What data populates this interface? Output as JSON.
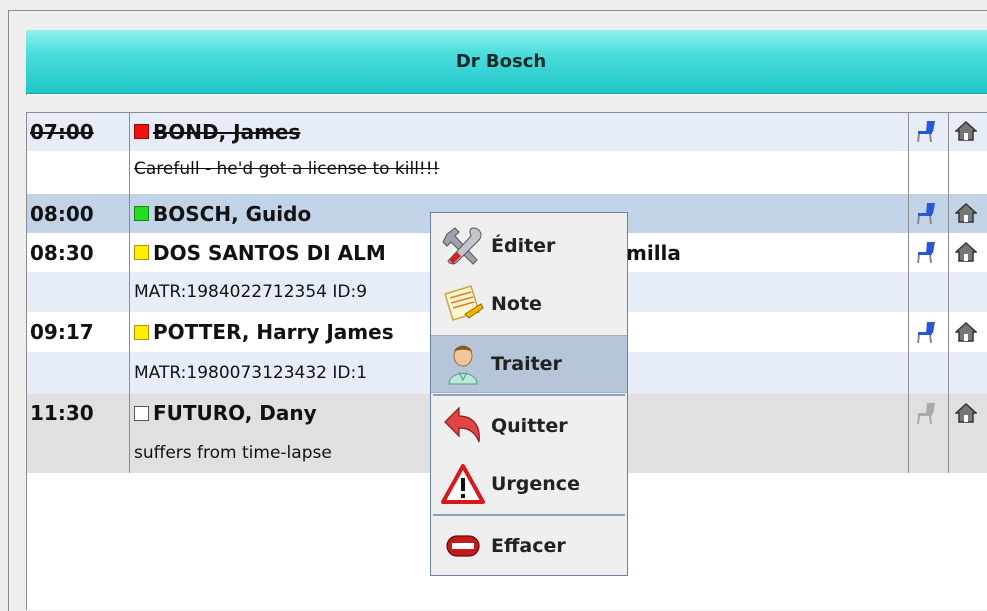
{
  "header": {
    "title": "Dr Bosch"
  },
  "appointments": [
    {
      "time": "07:00",
      "name": "BOND, James",
      "status": "#ee1111",
      "strike": true,
      "note": "Carefull - he'd got a license to kill!!!",
      "row_bg": "#e6edf8",
      "note_bg": "#ffffff",
      "chair_color": "#2a56d8"
    },
    {
      "time": "08:00",
      "name": "BOSCH, Guido",
      "status": "#22dd22",
      "strike": false,
      "row_bg": "#c2d3e8",
      "chair_color": "#2a56d8"
    },
    {
      "time": "08:30",
      "name": "DOS SANTOS DI ALM",
      "name_tail": "milla",
      "status": "#ffee00",
      "strike": false,
      "note": "MATR:1984022712354 ID:9",
      "row_bg": "#ffffff",
      "note_bg": "#e6edf8",
      "chair_color": "#2a56d8"
    },
    {
      "time": "09:17",
      "name": "POTTER, Harry James",
      "status": "#ffee00",
      "strike": false,
      "note": "MATR:1980073123432 ID:1",
      "row_bg": "#ffffff",
      "note_bg": "#e6edf8",
      "chair_color": "#2a56d8"
    },
    {
      "time": "11:30",
      "name": "FUTURO, Dany",
      "status": "#ffffff",
      "strike": false,
      "note": "suffers from time-lapse",
      "row_bg": "#e0e0e0",
      "note_bg": "#e0e0e0",
      "chair_color": "#a9a9a9"
    }
  ],
  "context_menu": {
    "items": [
      {
        "label": "Éditer",
        "icon": "tools-icon"
      },
      {
        "label": "Note",
        "icon": "note-icon"
      },
      {
        "label": "Traiter",
        "icon": "doctor-icon",
        "highlighted": true
      },
      {
        "label": "Quitter",
        "icon": "back-arrow-icon"
      },
      {
        "label": "Urgence",
        "icon": "warning-icon"
      },
      {
        "label": "Effacer",
        "icon": "delete-icon"
      }
    ]
  }
}
